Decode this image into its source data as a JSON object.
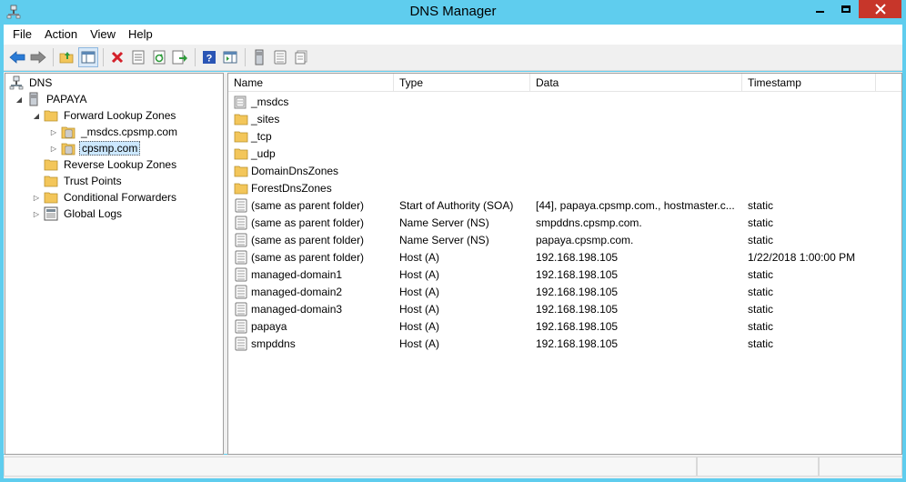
{
  "window": {
    "title": "DNS Manager",
    "accent_color": "#5fcdee",
    "close_color": "#c7362a"
  },
  "menu": {
    "items": [
      {
        "label": "File"
      },
      {
        "label": "Action"
      },
      {
        "label": "View"
      },
      {
        "label": "Help"
      }
    ]
  },
  "toolbar": {
    "buttons": [
      {
        "icon": "back-arrow-icon"
      },
      {
        "icon": "forward-arrow-icon"
      },
      {
        "icon": "up-folder-icon"
      },
      {
        "icon": "show-hide-console-tree-icon"
      },
      {
        "icon": "delete-icon"
      },
      {
        "icon": "properties-icon"
      },
      {
        "icon": "refresh-icon"
      },
      {
        "icon": "export-list-icon"
      },
      {
        "icon": "help-icon"
      },
      {
        "icon": "show-hide-action-pane-icon"
      },
      {
        "icon": "server-icon"
      },
      {
        "icon": "record-icon"
      },
      {
        "icon": "records-icon"
      }
    ]
  },
  "tree": {
    "nodes": [
      {
        "label": "DNS",
        "icon": "dns-icon"
      },
      {
        "label": "PAPAYA",
        "icon": "server-icon"
      },
      {
        "label": "Forward Lookup Zones",
        "icon": "folder-icon"
      },
      {
        "label": "_msdcs.cpsmp.com",
        "icon": "zone-icon"
      },
      {
        "label": "cpsmp.com",
        "icon": "zone-icon",
        "selected": true
      },
      {
        "label": "Reverse Lookup Zones",
        "icon": "folder-icon"
      },
      {
        "label": "Trust Points",
        "icon": "folder-icon"
      },
      {
        "label": "Conditional Forwarders",
        "icon": "folder-icon"
      },
      {
        "label": "Global Logs",
        "icon": "logs-icon"
      }
    ]
  },
  "list": {
    "columns": [
      {
        "label": "Name"
      },
      {
        "label": "Type"
      },
      {
        "label": "Data"
      },
      {
        "label": "Timestamp"
      }
    ],
    "rows": [
      {
        "name": "_msdcs",
        "type": "",
        "data": "",
        "timestamp": "",
        "icon": "delegated-zone-icon"
      },
      {
        "name": "_sites",
        "type": "",
        "data": "",
        "timestamp": "",
        "icon": "folder-icon"
      },
      {
        "name": "_tcp",
        "type": "",
        "data": "",
        "timestamp": "",
        "icon": "folder-icon"
      },
      {
        "name": "_udp",
        "type": "",
        "data": "",
        "timestamp": "",
        "icon": "folder-icon"
      },
      {
        "name": "DomainDnsZones",
        "type": "",
        "data": "",
        "timestamp": "",
        "icon": "folder-icon"
      },
      {
        "name": "ForestDnsZones",
        "type": "",
        "data": "",
        "timestamp": "",
        "icon": "folder-icon"
      },
      {
        "name": "(same as parent folder)",
        "type": "Start of Authority (SOA)",
        "data": "[44], papaya.cpsmp.com., hostmaster.c...",
        "timestamp": "static",
        "icon": "record-icon"
      },
      {
        "name": "(same as parent folder)",
        "type": "Name Server (NS)",
        "data": "smpddns.cpsmp.com.",
        "timestamp": "static",
        "icon": "record-icon"
      },
      {
        "name": "(same as parent folder)",
        "type": "Name Server (NS)",
        "data": "papaya.cpsmp.com.",
        "timestamp": "static",
        "icon": "record-icon"
      },
      {
        "name": "(same as parent folder)",
        "type": "Host (A)",
        "data": "192.168.198.105",
        "timestamp": "1/22/2018 1:00:00 PM",
        "icon": "record-icon"
      },
      {
        "name": "managed-domain1",
        "type": "Host (A)",
        "data": "192.168.198.105",
        "timestamp": "static",
        "icon": "record-icon"
      },
      {
        "name": "managed-domain2",
        "type": "Host (A)",
        "data": "192.168.198.105",
        "timestamp": "static",
        "icon": "record-icon"
      },
      {
        "name": "managed-domain3",
        "type": "Host (A)",
        "data": "192.168.198.105",
        "timestamp": "static",
        "icon": "record-icon"
      },
      {
        "name": "papaya",
        "type": "Host (A)",
        "data": "192.168.198.105",
        "timestamp": "static",
        "icon": "record-icon"
      },
      {
        "name": "smpddns",
        "type": "Host (A)",
        "data": "192.168.198.105",
        "timestamp": "static",
        "icon": "record-icon"
      }
    ]
  }
}
